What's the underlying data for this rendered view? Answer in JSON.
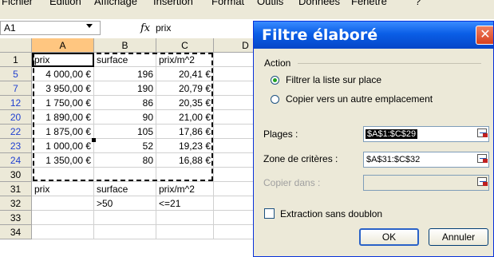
{
  "menu": [
    "Fichier",
    "Edition",
    "Affichage",
    "Insertion",
    "Format",
    "Outils",
    "Données",
    "Fenêtre",
    "?"
  ],
  "formula_bar": {
    "name_box": "A1",
    "fx": "fx",
    "formula": "prix"
  },
  "columns": [
    "A",
    "B",
    "C",
    "D"
  ],
  "rows": [
    {
      "num": "1",
      "a": "prix",
      "b": "surface",
      "c": "prix/m^2",
      "filtered": false
    },
    {
      "num": "5",
      "a": "4 000,00 €",
      "b": "196",
      "c": "20,41 €",
      "filtered": true
    },
    {
      "num": "7",
      "a": "3 950,00 €",
      "b": "190",
      "c": "20,79 €",
      "filtered": true
    },
    {
      "num": "12",
      "a": "1 750,00 €",
      "b": "86",
      "c": "20,35 €",
      "filtered": true
    },
    {
      "num": "20",
      "a": "1 890,00 €",
      "b": "90",
      "c": "21,00 €",
      "filtered": true
    },
    {
      "num": "22",
      "a": "1 875,00 €",
      "b": "105",
      "c": "17,86 €",
      "filtered": true
    },
    {
      "num": "23",
      "a": "1 000,00 €",
      "b": "52",
      "c": "19,23 €",
      "filtered": true
    },
    {
      "num": "24",
      "a": "1 350,00 €",
      "b": "80",
      "c": "16,88 €",
      "filtered": true
    },
    {
      "num": "30",
      "a": "",
      "b": "",
      "c": "",
      "filtered": false
    },
    {
      "num": "31",
      "a": "prix",
      "b": "surface",
      "c": "prix/m^2",
      "filtered": false
    },
    {
      "num": "32",
      "a": "",
      "b": ">50",
      "c": "<=21",
      "filtered": false
    },
    {
      "num": "33",
      "a": "",
      "b": "",
      "c": "",
      "filtered": false
    },
    {
      "num": "34",
      "a": "",
      "b": "",
      "c": "",
      "filtered": false
    }
  ],
  "dialog": {
    "title": "Filtre élaboré",
    "close": "✕",
    "action_label": "Action",
    "radio_filter": "Filtrer la liste sur place",
    "radio_copy": "Copier vers un autre emplacement",
    "plages_label": "Plages :",
    "plages_value": "$A$1:$C$29",
    "criteres_label": "Zone de critères :",
    "criteres_value": "$A$31:$C$32",
    "copier_label": "Copier dans :",
    "copier_value": "",
    "checkbox_label": "Extraction sans doublon",
    "ok": "OK",
    "cancel": "Annuler"
  },
  "colors": {
    "selected_header": "#FFC680",
    "filtered_row_number": "#1f3fd0",
    "title_bar": "#0A5EE6"
  }
}
